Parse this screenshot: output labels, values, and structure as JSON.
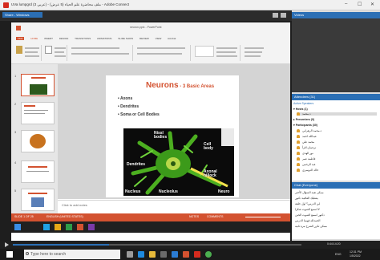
{
  "window": {
    "title": "UVa lumpgrd (3 عربي) - ملف محاضرة علم الحياء (5 عرض) - Adobe Connect",
    "min": "–",
    "max": "☐",
    "close": "✕"
  },
  "share_pod": {
    "label": "Share - Windows"
  },
  "videos_pod": {
    "label": "Videos"
  },
  "ppt": {
    "file_title": "neuron.pptx - PowerPoint",
    "tabs": [
      "FILE",
      "HOME",
      "INSERT",
      "DESIGN",
      "TRANSITIONS",
      "ANIMATIONS",
      "SLIDE SHOW",
      "REVIEW",
      "VIEW",
      "Acrobat"
    ],
    "thumb_numbers": [
      "1",
      "2",
      "3",
      "4",
      "5"
    ],
    "notes_placeholder": "Click to add notes",
    "status_left": "SLIDE 1 OF 25",
    "status_lang": "ENGLISH (UNITED STATES)",
    "status_notes": "NOTES",
    "status_comments": "COMMENTS"
  },
  "slide": {
    "title": "Neurons",
    "subtitle": " - 3 Basic Areas",
    "bullets": [
      "Axons",
      "Dendrites",
      "Soma or Cell Bodies"
    ],
    "image_labels": [
      "Nissl bodies",
      "Cell body",
      "Dendrites",
      "Axonal hillock",
      "Nucleus",
      "Nucleolus",
      "Neuro"
    ]
  },
  "attendees": {
    "header": "Attendees (31)",
    "active_speakers": "Active Speakers",
    "hosts_label": "▾ Hosts (1)",
    "host_name": "د.محمد",
    "presenters_label": "▸ Presenters (0)",
    "participants_label": "▾ Participants (30)",
    "participants": [
      "د.محمد الزهراني",
      "عبدالله احمد",
      "محمد علي",
      "ترجمان اقرأ",
      "نور الهدى",
      "فاطمة عمر",
      "عبد الرحمن",
      "خالد الدوسري"
    ]
  },
  "chat": {
    "header": "Chat (Everyone)",
    "messages": [
      "ممكن تعيد السؤال الأخير",
      "يعطيك العافية دكتور",
      "اين الدرس؟ اول حلقة",
      "لا اسمع الصوت شكرا",
      "دكتور اسمع الصوت الحين",
      "الحمدلله فهمنا الدرس",
      "ممكن تكرر الشرح مرة ثانية"
    ]
  },
  "connect_bar": {
    "time": "0:44:14:20"
  },
  "taskbar": {
    "search_placeholder": "Type here to search",
    "clock": "12:31 PM",
    "date": "1/5/2022",
    "lang": "ENG"
  }
}
